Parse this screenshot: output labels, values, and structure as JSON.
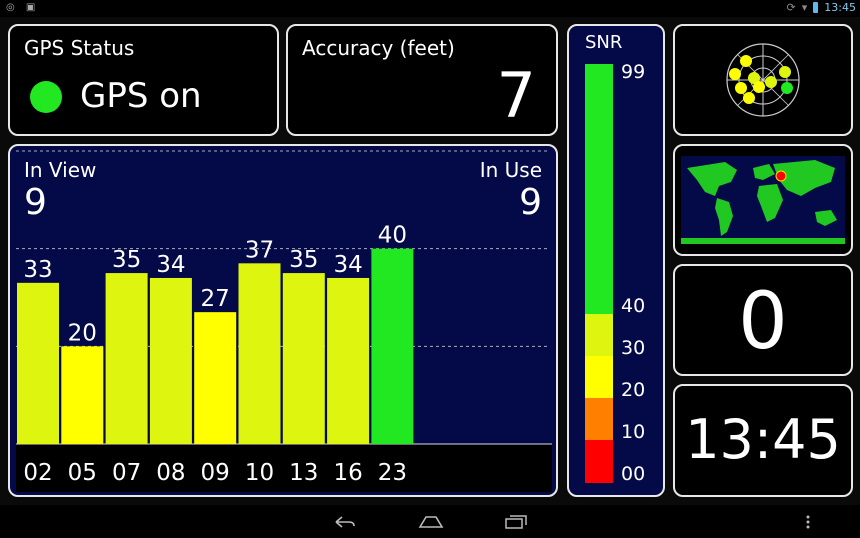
{
  "status_bar": {
    "time": "13:45",
    "left_icons": [
      "location-icon",
      "image-icon"
    ],
    "right_icons": [
      "sync-icon",
      "wifi-icon",
      "battery-icon"
    ]
  },
  "gps_status": {
    "label": "GPS Status",
    "value": "GPS on",
    "indicator_color": "#22e822"
  },
  "accuracy": {
    "label": "Accuracy (feet)",
    "value": "7"
  },
  "satellites": {
    "in_view_label": "In View",
    "in_view_value": "9",
    "in_use_label": "In Use",
    "in_use_value": "9"
  },
  "snr": {
    "title": "SNR",
    "ticks": [
      "99",
      "40",
      "30",
      "20",
      "10",
      "00"
    ],
    "colors": {
      "high": "#22e822",
      "mid_high": "#ddf50f",
      "mid": "#ffff00",
      "low": "#ff8000",
      "very_low": "#ff0000"
    }
  },
  "chart_data": {
    "type": "bar",
    "categories": [
      "02",
      "05",
      "07",
      "08",
      "09",
      "10",
      "13",
      "16",
      "23"
    ],
    "values": [
      33,
      20,
      35,
      34,
      27,
      37,
      35,
      34,
      40
    ],
    "ylim": [
      0,
      60
    ]
  },
  "counter": {
    "value": "0"
  },
  "clock": {
    "value": "13:45"
  },
  "nav_bar": {
    "icons": [
      "back-icon",
      "home-icon",
      "recents-icon",
      "menu-icon"
    ]
  }
}
